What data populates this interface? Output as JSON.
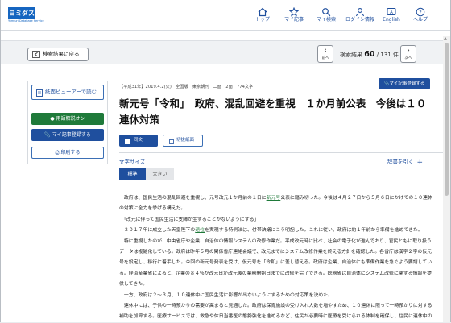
{
  "header": {
    "logo_text": "ヨミダス",
    "logo_sub": "Yomiuri Database Service",
    "nav": [
      {
        "label": "トップ",
        "icon": "home-icon"
      },
      {
        "label": "マイ記事",
        "icon": "star-icon"
      },
      {
        "label": "マイ検索",
        "icon": "search-icon"
      },
      {
        "label": "ログイン情報",
        "icon": "user-icon"
      },
      {
        "label": "English",
        "icon": "language-icon"
      },
      {
        "label": "ヘルプ",
        "icon": "help-icon"
      }
    ]
  },
  "results": {
    "back_label": "検索結果に戻る",
    "prev_label": "前へ",
    "next_label": "次へ",
    "count_prefix": "検索結果",
    "current": "60",
    "total": "/ 131 件"
  },
  "left_panel": {
    "viewer_label": "紙面ビューアーで読む",
    "glossary_label": "用語解説オン",
    "myclip_label": "マイ記事登録する",
    "print_label": "印刷する"
  },
  "article": {
    "meta": "【平成31年】2019.4.2(火)　全国版　東京朝刊　二面　2面　774文字",
    "register_label": "マイ記事登録する",
    "title": "新元号「令和」　政府、混乱回避を重視　１か月前公表　今後は１０連休対策",
    "plain_label": "同文",
    "cut_label": "切抜紙面",
    "font_size_label": "文字サイズ",
    "font_std": "標準",
    "font_large": "大きい",
    "dict_label": "辞書を引く",
    "paragraphs": [
      {
        "pre": "　政府は、国民生活の混乱回避を重視し、元号改元１か月前の１日に",
        "link": "新元号",
        "post": "公表に踏み切った。今後は４月２７日から５月６日にかけての１０連休の対策に全力を挙げる構えだ。"
      },
      {
        "pre": "　「改元に伴って国民生活に支障が生ずることがないようにする」",
        "link": "",
        "post": ""
      },
      {
        "pre": "　２０１７年に成立した天皇陛下の",
        "link": "退位",
        "post": "を実現する特例法は、付帯決議にこう明記した。これに従い、政府は約１年前から準備を進めてきた。"
      },
      {
        "pre": "　特に重視したのが、中央省庁や企業、自治体の情報システムの改修作業だ。平成改元時に比べ、社会の電子化が進んでおり、官民ともに取り扱うデータは複雑化している。政府は昨年５月の関係省庁連絡会議で、改元までにシステム改修作業を終える方針を確認した。各省庁は漢字２字の仮元号を設定し、移行に着手した。今回の新元号発表を受け、仮元号を「令和」に差し替える。政府は企業、自治体にも準備作業を急ぐよう要請している。経済産業省によると、企業の８４％が改元日が改元後の業務開始日までに改修を完了できる。総務省は自治体にシステム改修に関する情報を提供してきた。",
        "link": "",
        "post": ""
      },
      {
        "pre": "　一方、政府は２〜３月、１０連休中に国民生活に影響が出ないようにするための対応策を決めた。",
        "link": "",
        "post": ""
      },
      {
        "pre": "　連休中には、子供の一時預かりの需要が高まると見通した。政府は保育施設の受け入れ人数を増やすため、１０連休に限って一時預かりに対する補助を加算する。医療サービスでは、救急や休日当番医の態勢強化を進めるなど、住民が必要時に医療を受けられる体制を確保し、住民に連休中の",
        "link": "",
        "post": ""
      }
    ]
  },
  "colors": {
    "brand_blue": "#1f4f9e",
    "glossary_green": "#1f7a3a"
  }
}
